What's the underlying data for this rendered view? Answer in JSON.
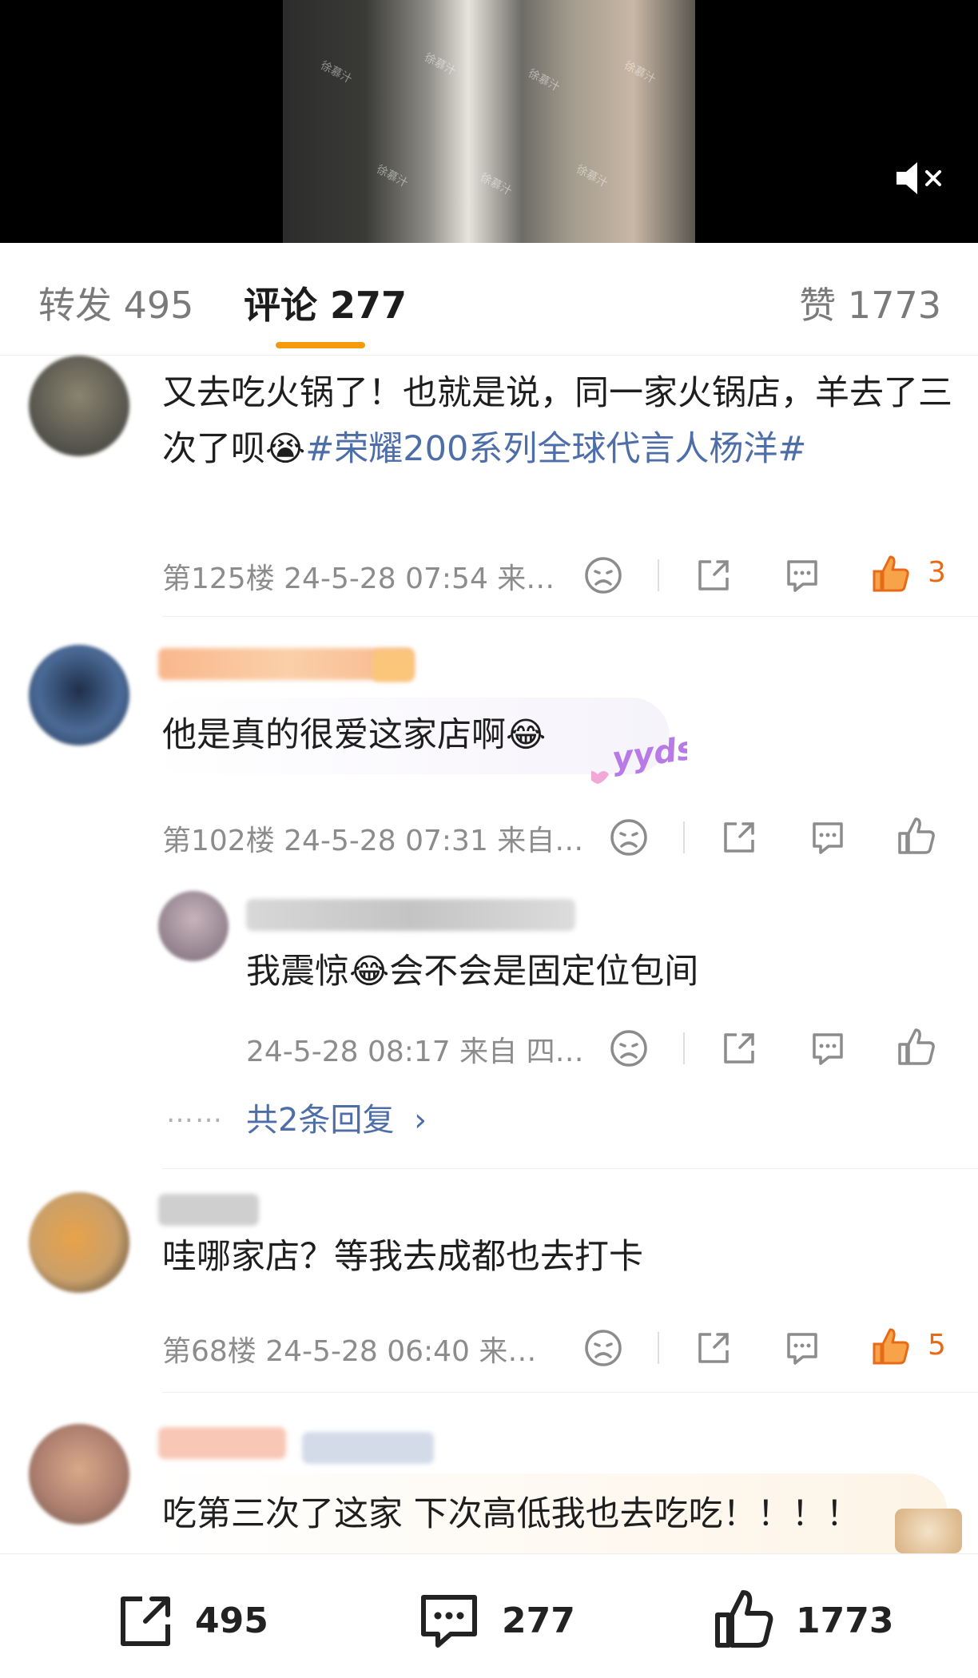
{
  "video": {
    "watermark": "徐慕汁"
  },
  "tabs": {
    "repost_label": "转发",
    "repost_count": "495",
    "comment_label": "评论",
    "comment_count": "277",
    "like_label": "赞",
    "like_count": "1773"
  },
  "comments": [
    {
      "text": "又去吃火锅了！也就是说，同一家火锅店，羊去了三次了呗😭",
      "topic": "#荣耀200系列全球代言人杨洋#",
      "meta": "第125楼  24-5-28 07:54  来…",
      "likes": "3"
    },
    {
      "text": "他是真的很爱这家店啊😂",
      "sticker": "yyds",
      "meta": "第102楼  24-5-28 07:31  来自…",
      "likes": "",
      "reply": {
        "text": "我震惊😂会不会是固定位包间",
        "meta": "24-5-28 08:17  来自  四…"
      },
      "more_dots": "……",
      "more_replies": "共2条回复",
      "more_chevron": "›"
    },
    {
      "text": "哇哪家店？等我去成都也去打卡",
      "meta": "第68楼  24-5-28 06:40  来…",
      "likes": "5"
    },
    {
      "text": "吃第三次了这家 下次高低我也去吃吃！！！！"
    }
  ],
  "bottom_bar": {
    "repost": "495",
    "comment": "277",
    "like": "1773"
  },
  "colors": {
    "accent": "#f59a0c",
    "topic": "#4e6ea8",
    "like_active": "#e86a17"
  }
}
